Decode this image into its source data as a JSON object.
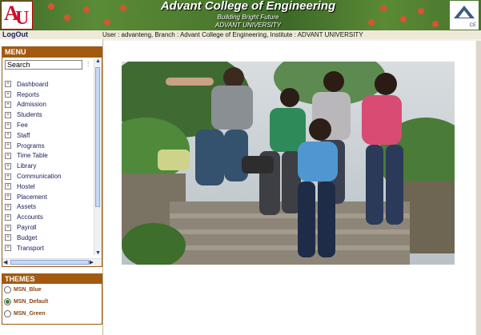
{
  "header": {
    "logo_text": "AU",
    "title": "Advant College of Engineering",
    "tagline": "Building Bright Future",
    "university": "ADVANT UNIVERSITY",
    "right_logo_text": "CE",
    "background_color": "#4f7d2f"
  },
  "topbar": {
    "logout_label": "LogOut",
    "user_info": "User : advanteng, Branch : Advant College of Engineering, Institute : ADVANT UNIVERSITY"
  },
  "menu": {
    "title": "MENU",
    "search_value": "Search",
    "items": [
      {
        "label": "Dashboard"
      },
      {
        "label": "Reports"
      },
      {
        "label": "Admission"
      },
      {
        "label": "Students"
      },
      {
        "label": "Fee"
      },
      {
        "label": "Staff"
      },
      {
        "label": "Programs"
      },
      {
        "label": "Time Table"
      },
      {
        "label": "Library"
      },
      {
        "label": "Communication"
      },
      {
        "label": "Hostel"
      },
      {
        "label": "Placement"
      },
      {
        "label": "Assets"
      },
      {
        "label": "Accounts"
      },
      {
        "label": "Payroll"
      },
      {
        "label": "Budget"
      },
      {
        "label": "Transport"
      }
    ]
  },
  "themes": {
    "title": "THEMES",
    "options": [
      "MSN_Blue",
      "MSN_Default",
      "MSN_Green"
    ],
    "selected": "MSN_Default"
  },
  "colors": {
    "panel_header": "#a35a10",
    "theme_text": "#8b4513",
    "menu_text": "#1b1b5e"
  }
}
